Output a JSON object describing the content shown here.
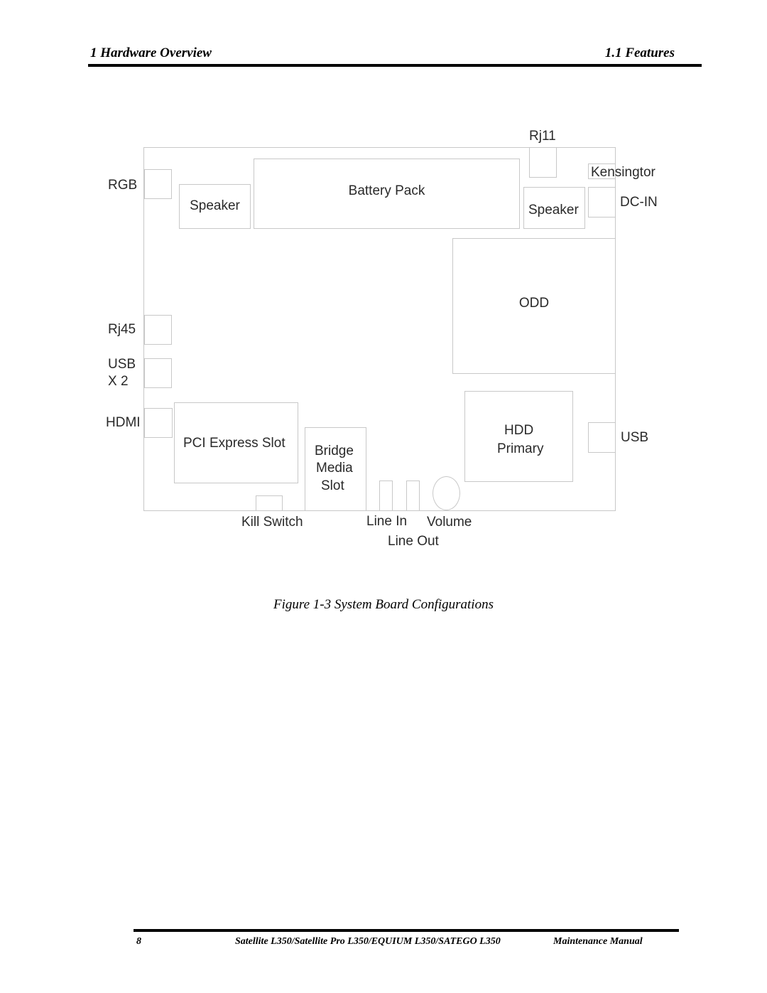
{
  "header": {
    "chapter": "1 Hardware Overview",
    "section": "1.1 Features"
  },
  "diagram": {
    "external_labels": {
      "rgb": "RGB",
      "rj11": "Rj11",
      "kensington": "Kensingtor",
      "dc_in": "DC-IN",
      "rj45": "Rj45",
      "usb_x2_line1": "USB",
      "usb_x2_line2": "X 2",
      "hdmi": "HDMI",
      "usb": "USB",
      "kill_switch": "Kill Switch",
      "line_in": "Line In",
      "volume": "Volume",
      "line_out": "Line Out"
    },
    "components": {
      "speaker_left": "Speaker",
      "battery_pack": "Battery Pack",
      "speaker_right": "Speaker",
      "odd": "ODD",
      "pci_express_slot": "PCI Express Slot",
      "bridge_media_slot_line1": "Bridge",
      "bridge_media_slot_line2": "Media",
      "bridge_media_slot_line3": "Slot",
      "hdd_line1": "HDD",
      "hdd_line2": "Primary"
    }
  },
  "caption": "Figure 1-3 System Board Configurations",
  "footer": {
    "page_number": "8",
    "product_title": "Satellite L350/Satellite Pro L350/EQUIUM L350/SATEGO L350",
    "manual": "Maintenance Manual"
  }
}
